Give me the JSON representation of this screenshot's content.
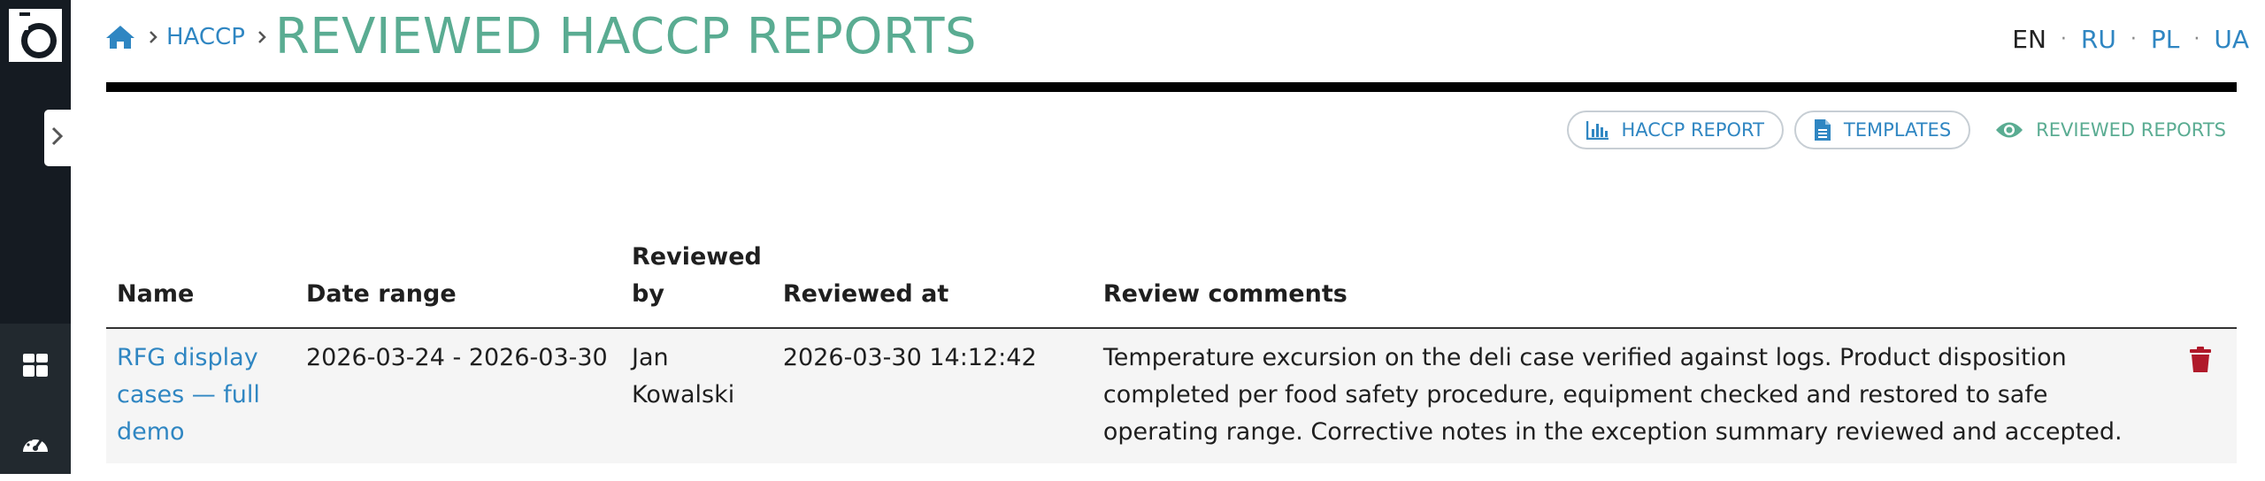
{
  "sidebar": {
    "logo_icon": "lens-logo-icon",
    "expand_icon": "chevron-right-icon",
    "nav": [
      {
        "icon": "dashboard-grid-icon"
      },
      {
        "icon": "speedometer-icon"
      }
    ]
  },
  "breadcrumb": {
    "home_icon": "home-icon",
    "items": [
      "HACCP"
    ],
    "title": "REVIEWED HACCP REPORTS"
  },
  "languages": {
    "items": [
      "EN",
      "RU",
      "PL",
      "UA"
    ],
    "active": "EN",
    "separator": "·"
  },
  "actions": {
    "haccp_report": {
      "label": "HACCP REPORT",
      "icon": "bar-chart-icon"
    },
    "templates": {
      "label": "TEMPLATES",
      "icon": "document-icon"
    },
    "reviewed_reports": {
      "label": "REVIEWED REPORTS",
      "icon": "eye-icon"
    }
  },
  "table": {
    "columns": [
      "Name",
      "Date range",
      "Reviewed by",
      "Reviewed at",
      "Review comments"
    ],
    "rows": [
      {
        "name": "RFG display cases — full demo",
        "date_range": "2026-03-24 - 2026-03-30",
        "reviewed_by": "Jan Kowalski",
        "reviewed_at": "2026-03-30 14:12:42",
        "comments": "Temperature excursion on the deli case verified against logs. Product disposition completed per food safety procedure, equipment checked and restored to safe operating range. Corrective notes in the exception summary reviewed and accepted.",
        "delete_icon": "trash-icon"
      }
    ]
  },
  "colors": {
    "sidebar": "#151b22",
    "link": "#2f86c2",
    "title": "#5aac92",
    "danger": "#b0192a"
  }
}
